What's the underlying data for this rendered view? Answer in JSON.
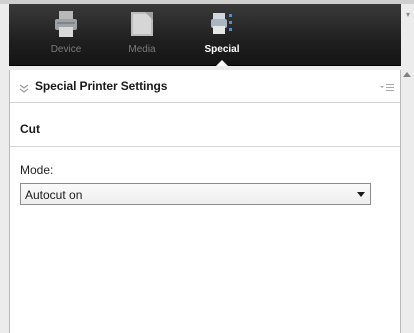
{
  "toolbar": {
    "buttons": [
      {
        "label": "Device",
        "icon": "printer-icon",
        "active": false
      },
      {
        "label": "Media",
        "icon": "media-icon",
        "active": false
      },
      {
        "label": "Special",
        "icon": "special-settings-icon",
        "active": true
      }
    ]
  },
  "panel": {
    "title": "Special Printer Settings",
    "section": {
      "title": "Cut",
      "mode_label": "Mode:",
      "mode_value": "Autocut on"
    }
  },
  "colors": {
    "toolbar_bg": "#1f1f1f",
    "active_label": "#ffffff",
    "inactive_label": "#7b7b7b"
  }
}
